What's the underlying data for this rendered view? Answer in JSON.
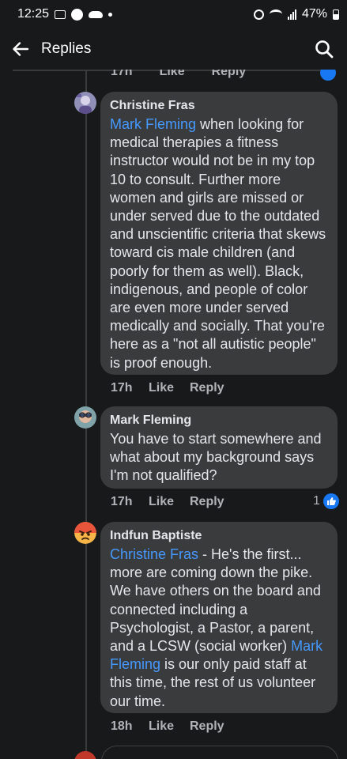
{
  "status_bar": {
    "time": "12:25",
    "battery": "47%"
  },
  "app_bar": {
    "title": "Replies"
  },
  "clipped_top": {
    "time": "17h",
    "like": "Like",
    "reply": "Reply"
  },
  "comments": [
    {
      "author": "Christine Fras",
      "mention": "Mark Fleming",
      "text": " when looking for medical therapies a fitness instructor would not be in my top 10 to consult. Further more women and girls are missed or under served due to the outdated and unscientific criteria that skews toward cis male children (and poorly for them as well). Black, indigenous, and people of color are even more under served medically and socially. That you're here as a \"not all autistic people\" is proof enough.",
      "time": "17h",
      "like": "Like",
      "reply": "Reply"
    },
    {
      "author": "Mark Fleming",
      "text": "You have to start somewhere and what about my background says I'm not qualified?",
      "time": "17h",
      "like": "Like",
      "reply": "Reply",
      "reaction_count": "1"
    },
    {
      "author": "Indfun Baptiste",
      "mention": "Christine Fras",
      "text_a": " - He's the first... more are coming down the pike. We have others on the board and connected including a Psychologist, a Pastor, a parent, and a LCSW (social worker) ",
      "mention2": "Mark Fleming",
      "text_b": " is our only paid staff at this time, the rest of us volunteer our time.",
      "time": "18h",
      "like": "Like",
      "reply": "Reply"
    }
  ],
  "colors": {
    "background": "#18191a",
    "bubble": "#3a3b3c",
    "mention": "#4599ff",
    "like_badge": "#1877f2"
  }
}
